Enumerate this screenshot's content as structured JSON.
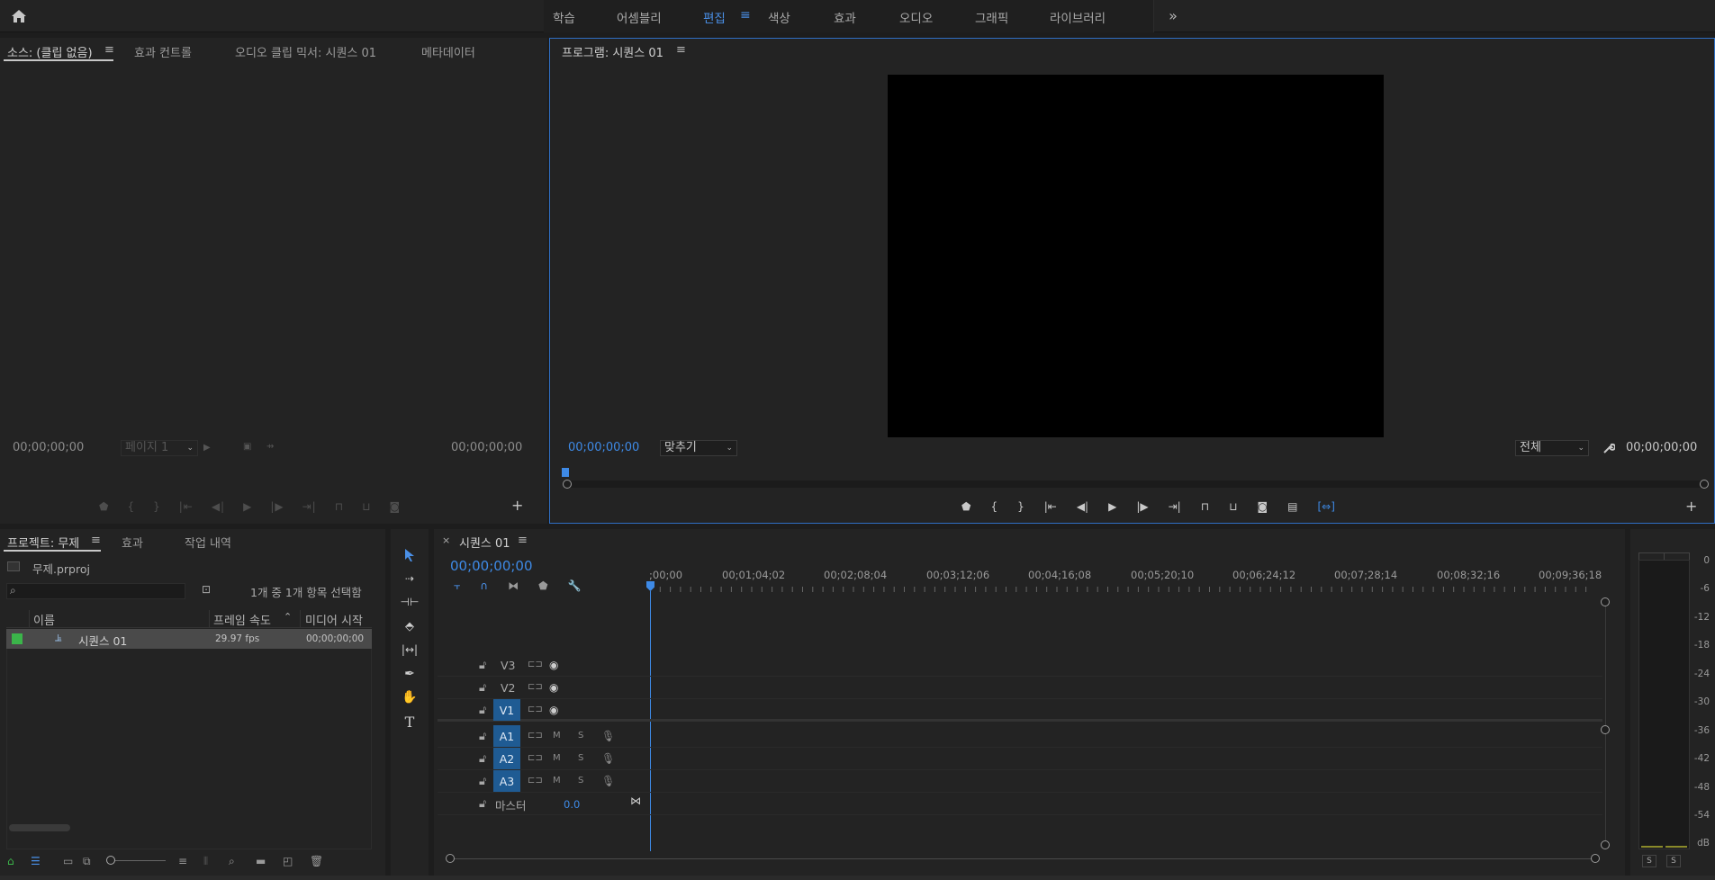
{
  "workspaces": {
    "items": [
      "학습",
      "어셈블리",
      "편집",
      "색상",
      "효과",
      "오디오",
      "그래픽",
      "라이브러리"
    ],
    "active": "편집"
  },
  "source_panel": {
    "tabs": [
      "소스: (클립 없음)",
      "효과 컨트롤",
      "오디오 클립 믹서: 시퀀스 01",
      "메타데이터"
    ],
    "tc_left": "00;00;00;00",
    "page_select": "페이지 1",
    "tc_right": "00;00;00;00"
  },
  "program_panel": {
    "title": "프로그램: 시퀀스 01",
    "tc_left": "00;00;00;00",
    "fit_select": "맞추기",
    "quality_select": "전체",
    "tc_right": "00;00;00;00"
  },
  "project_panel": {
    "tabs": [
      "프로젝트: 무제",
      "효과",
      "작업 내역"
    ],
    "file_name": "무제.prproj",
    "search_placeholder": "",
    "selection_status": "1개 중 1개 항목 선택함",
    "columns": [
      "이름",
      "프레임 속도",
      "미디어 시작"
    ],
    "items": [
      {
        "name": "시퀀스 01",
        "fps": "29.97 fps",
        "start": "00;00;00;00",
        "label_color": "#3bb54a"
      }
    ]
  },
  "timeline": {
    "tab": "시퀀스 01",
    "timecode": "00;00;00;00",
    "ruler": [
      ";00;00",
      "00;01;04;02",
      "00;02;08;04",
      "00;03;12;06",
      "00;04;16;08",
      "00;05;20;10",
      "00;06;24;12",
      "00;07;28;14",
      "00;08;32;16",
      "00;09;36;18"
    ],
    "video_tracks": [
      "V3",
      "V2",
      "V1"
    ],
    "audio_tracks": [
      "A1",
      "A2",
      "A3"
    ],
    "mute_label": "M",
    "solo_label": "S",
    "master_label": "마스터",
    "master_value": "0.0"
  },
  "meter": {
    "scale": [
      "0",
      "-6",
      "-12",
      "-18",
      "-24",
      "-30",
      "-36",
      "-42",
      "-48",
      "-54",
      "dB"
    ],
    "solo_buttons": [
      "S",
      "S"
    ]
  },
  "colors": {
    "accent": "#3e8ae6",
    "track_active": "#1f5b93",
    "panel_bg": "#232323",
    "label_green": "#3bb54a"
  }
}
